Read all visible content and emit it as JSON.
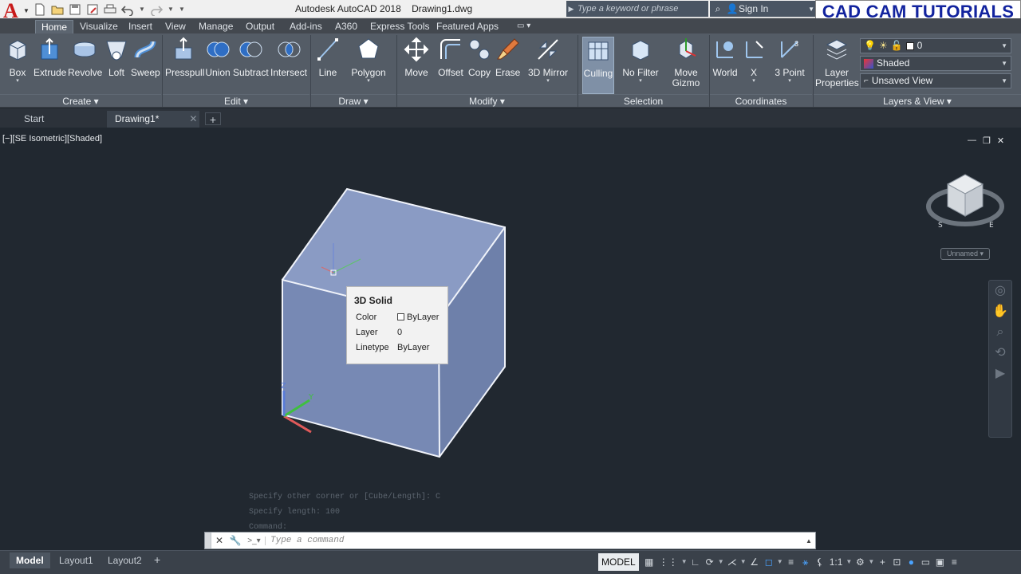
{
  "app": {
    "title": "Autodesk AutoCAD 2018",
    "document": "Drawing1.dwg",
    "search_placeholder": "Type a keyword or phrase",
    "sign_in": "Sign In",
    "watermark": "CAD CAM TUTORIALS"
  },
  "ribbon_tabs": [
    "Home",
    "Visualize",
    "Insert",
    "View",
    "Manage",
    "Output",
    "Add-ins",
    "A360",
    "Express Tools",
    "Featured Apps"
  ],
  "tools": {
    "box": "Box",
    "extrude": "Extrude",
    "revolve": "Revolve",
    "loft": "Loft",
    "sweep": "Sweep",
    "presspull": "Presspull",
    "union": "Union",
    "subtract": "Subtract",
    "intersect": "Intersect",
    "line": "Line",
    "polygon": "Polygon",
    "move": "Move",
    "offset": "Offset",
    "copy": "Copy",
    "erase": "Erase",
    "mirror3d": "3D Mirror",
    "culling": "Culling",
    "no_filter": "No Filter",
    "move_gizmo_1": "Move",
    "move_gizmo_2": "Gizmo",
    "world": "World",
    "x": "X",
    "three_point": "3 Point",
    "layer_properties_1": "Layer",
    "layer_properties_2": "Properties"
  },
  "panels": {
    "create": "Create",
    "edit": "Edit",
    "draw": "Draw",
    "modify": "Modify",
    "selection": "Selection",
    "coordinates": "Coordinates",
    "layers_view": "Layers & View"
  },
  "layer_controls": {
    "layer": "0",
    "visual_style": "Shaded",
    "view": "Unsaved View"
  },
  "file_tabs": {
    "start": "Start",
    "drawing": "Drawing1*",
    "close": "✕",
    "add": "+"
  },
  "viewport": {
    "label": "[−][SE Isometric][Shaded]",
    "controls": [
      "—",
      "❐",
      "✕"
    ],
    "ucs_name": "Unnamed"
  },
  "tooltip": {
    "title": "3D Solid",
    "rows": [
      {
        "key": "Color",
        "value": "ByLayer"
      },
      {
        "key": "Layer",
        "value": "0"
      },
      {
        "key": "Linetype",
        "value": "ByLayer"
      }
    ]
  },
  "command_history": [
    "Specify other corner or [Cube/Length]: C",
    "Specify length: 100",
    "Command:"
  ],
  "command_placeholder": "Type a command",
  "layout_tabs": [
    "Model",
    "Layout1",
    "Layout2"
  ],
  "status": {
    "model": "MODEL",
    "scale": "1:1"
  },
  "colors": {
    "viewport_bg": "#212830",
    "ribbon_bg": "#545c66",
    "solid_top": "#8a9bc4",
    "solid_front": "#7789b4",
    "solid_right": "#6e80aa",
    "brand_red": "#c81a1a",
    "watermark_blue": "#12239e"
  }
}
